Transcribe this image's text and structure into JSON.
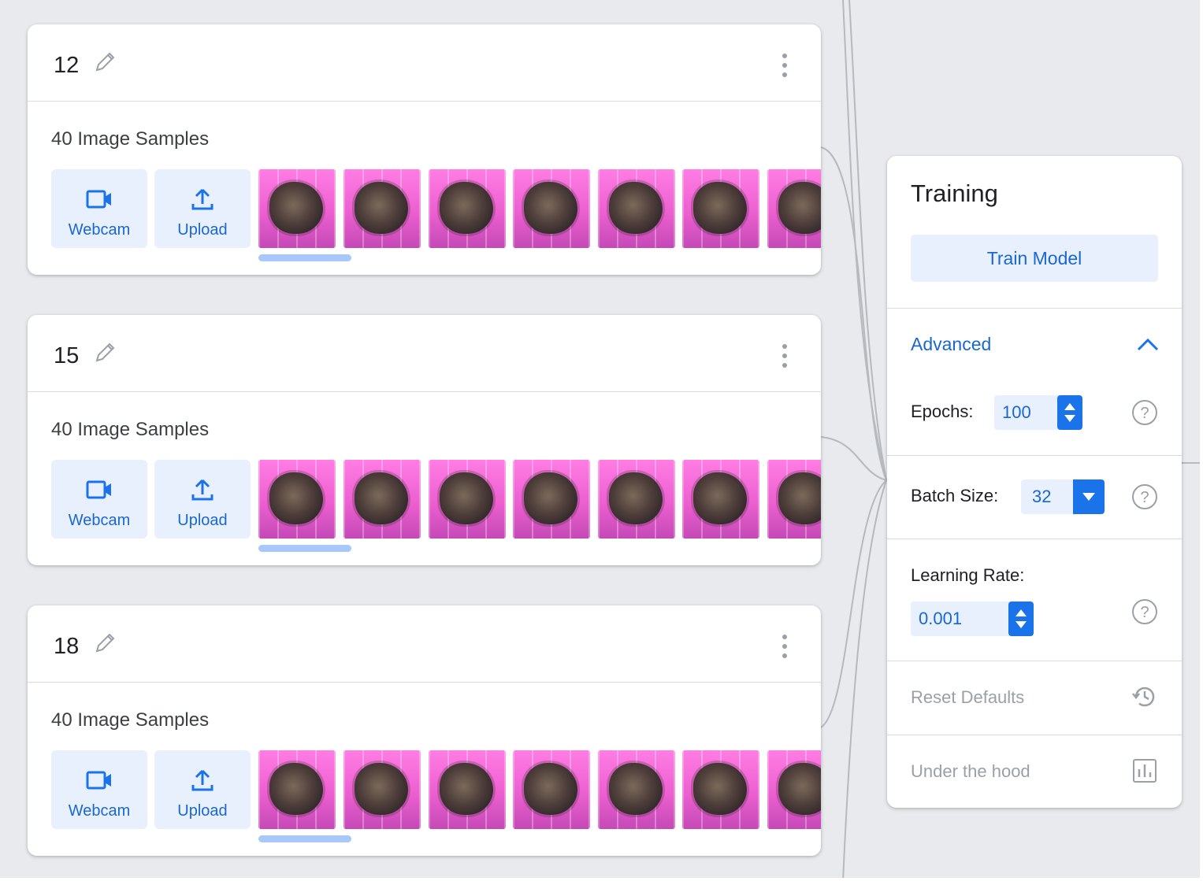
{
  "classes": [
    {
      "name": "12",
      "sample_count": "40 Image Samples",
      "webcam_label": "Webcam",
      "upload_label": "Upload"
    },
    {
      "name": "15",
      "sample_count": "40 Image Samples",
      "webcam_label": "Webcam",
      "upload_label": "Upload"
    },
    {
      "name": "18",
      "sample_count": "40 Image Samples",
      "webcam_label": "Webcam",
      "upload_label": "Upload"
    }
  ],
  "training": {
    "title": "Training",
    "train_button": "Train Model",
    "advanced": {
      "label": "Advanced",
      "expanded": true,
      "epochs": {
        "label": "Epochs:",
        "value": "100"
      },
      "batch_size": {
        "label": "Batch Size:",
        "value": "32"
      },
      "learning_rate": {
        "label": "Learning Rate:",
        "value": "0.001"
      }
    },
    "reset_defaults": "Reset Defaults",
    "under_the_hood": "Under the hood"
  },
  "icons": {
    "class_card": [
      "pencil-icon",
      "more-vert-icon",
      "webcam-icon",
      "upload-icon"
    ],
    "training": [
      "chevron-up-icon",
      "spinner-icon",
      "dropdown-arrow-icon",
      "help-icon",
      "history-icon",
      "bar-chart-icon"
    ]
  },
  "colors": {
    "accent": "#1a73e8",
    "accent_text": "#1967d2",
    "button_bg": "#e8f0fe",
    "scroll_indicator": "#a8c7fa",
    "background": "#e8eaed",
    "thumbnail_pink": "#ec5fd0"
  }
}
